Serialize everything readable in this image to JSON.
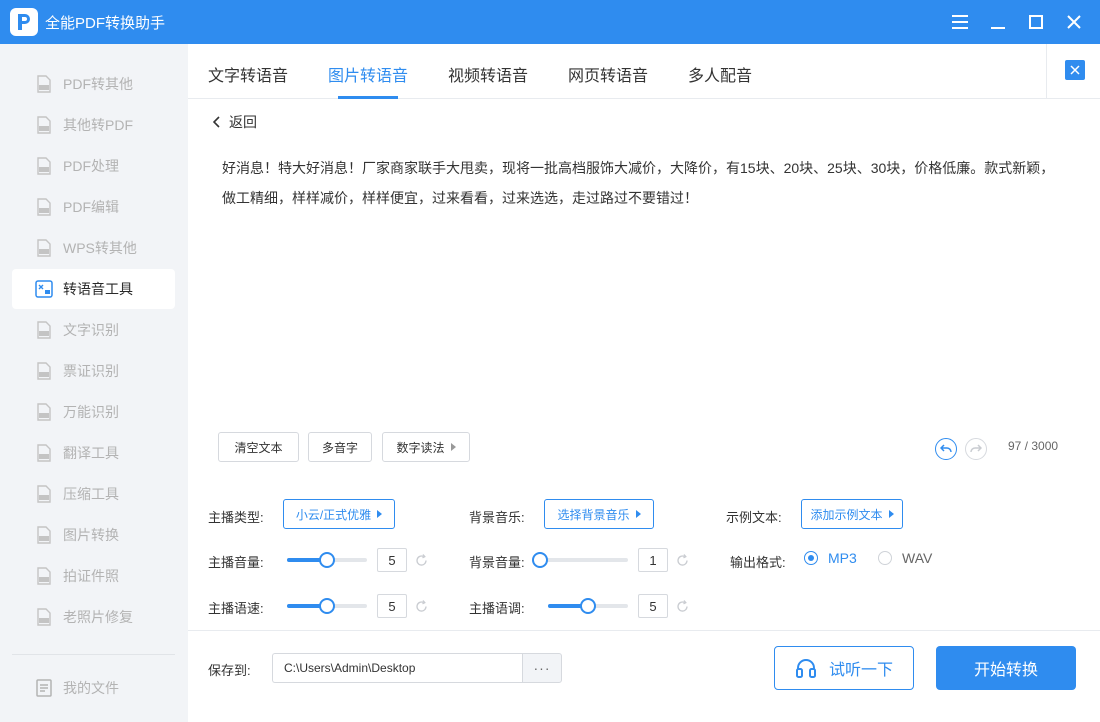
{
  "app": {
    "title": "全能PDF转换助手"
  },
  "sidebar": {
    "items": [
      {
        "label": "PDF转其他",
        "icon": "pdf-convert-icon"
      },
      {
        "label": "其他转PDF",
        "icon": "to-pdf-icon"
      },
      {
        "label": "PDF处理",
        "icon": "pdf-process-icon"
      },
      {
        "label": "PDF编辑",
        "icon": "pdf-edit-icon"
      },
      {
        "label": "WPS转其他",
        "icon": "wps-icon"
      },
      {
        "label": "转语音工具",
        "icon": "voice-tool-icon"
      },
      {
        "label": "文字识别",
        "icon": "text-ocr-icon"
      },
      {
        "label": "票证识别",
        "icon": "ticket-ocr-icon"
      },
      {
        "label": "万能识别",
        "icon": "universal-ocr-icon"
      },
      {
        "label": "翻译工具",
        "icon": "translate-icon"
      },
      {
        "label": "压缩工具",
        "icon": "compress-icon"
      },
      {
        "label": "图片转换",
        "icon": "image-convert-icon"
      },
      {
        "label": "拍证件照",
        "icon": "id-photo-icon"
      },
      {
        "label": "老照片修复",
        "icon": "photo-repair-icon"
      }
    ],
    "active_index": 5,
    "my_files": "我的文件"
  },
  "tabs": [
    "文字转语音",
    "图片转语音",
    "视频转语音",
    "网页转语音",
    "多人配音"
  ],
  "active_tab": 1,
  "back_label": "返回",
  "content_text": "好消息！特大好消息！厂家商家联手大甩卖，现将一批高档服饰大减价，大降价，有15块、20块、25块、30块，价格低廉。款式新颖，做工精细，样样减价，样样便宜，过来看看，过来选选，走过路过不要错过！",
  "tools": {
    "clear": "清空文本",
    "polyphone": "多音字",
    "number_reading": "数字读法"
  },
  "counter": "97 / 3000",
  "settings": {
    "anchor_type_label": "主播类型:",
    "anchor_type_value": "小云/正式优雅",
    "bgm_label": "背景音乐:",
    "bgm_value": "选择背景音乐",
    "sample_label": "示例文本:",
    "sample_value": "添加示例文本",
    "anchor_volume_label": "主播音量:",
    "anchor_volume_value": "5",
    "bg_volume_label": "背景音量:",
    "bg_volume_value": "1",
    "format_label": "输出格式:",
    "format_options": [
      "MP3",
      "WAV"
    ],
    "format_selected": "MP3",
    "speed_label": "主播语速:",
    "speed_value": "5",
    "pitch_label": "主播语调:",
    "pitch_value": "5",
    "anchor_volume_level": 0.5,
    "bg_volume_level": 0.0,
    "speed_level": 0.5,
    "pitch_level": 0.5
  },
  "save": {
    "label": "保存到:",
    "path": "C:\\Users\\Admin\\Desktop",
    "browse": "···"
  },
  "actions": {
    "listen": "试听一下",
    "start": "开始转换"
  },
  "colors": {
    "primary": "#2f8cef"
  }
}
